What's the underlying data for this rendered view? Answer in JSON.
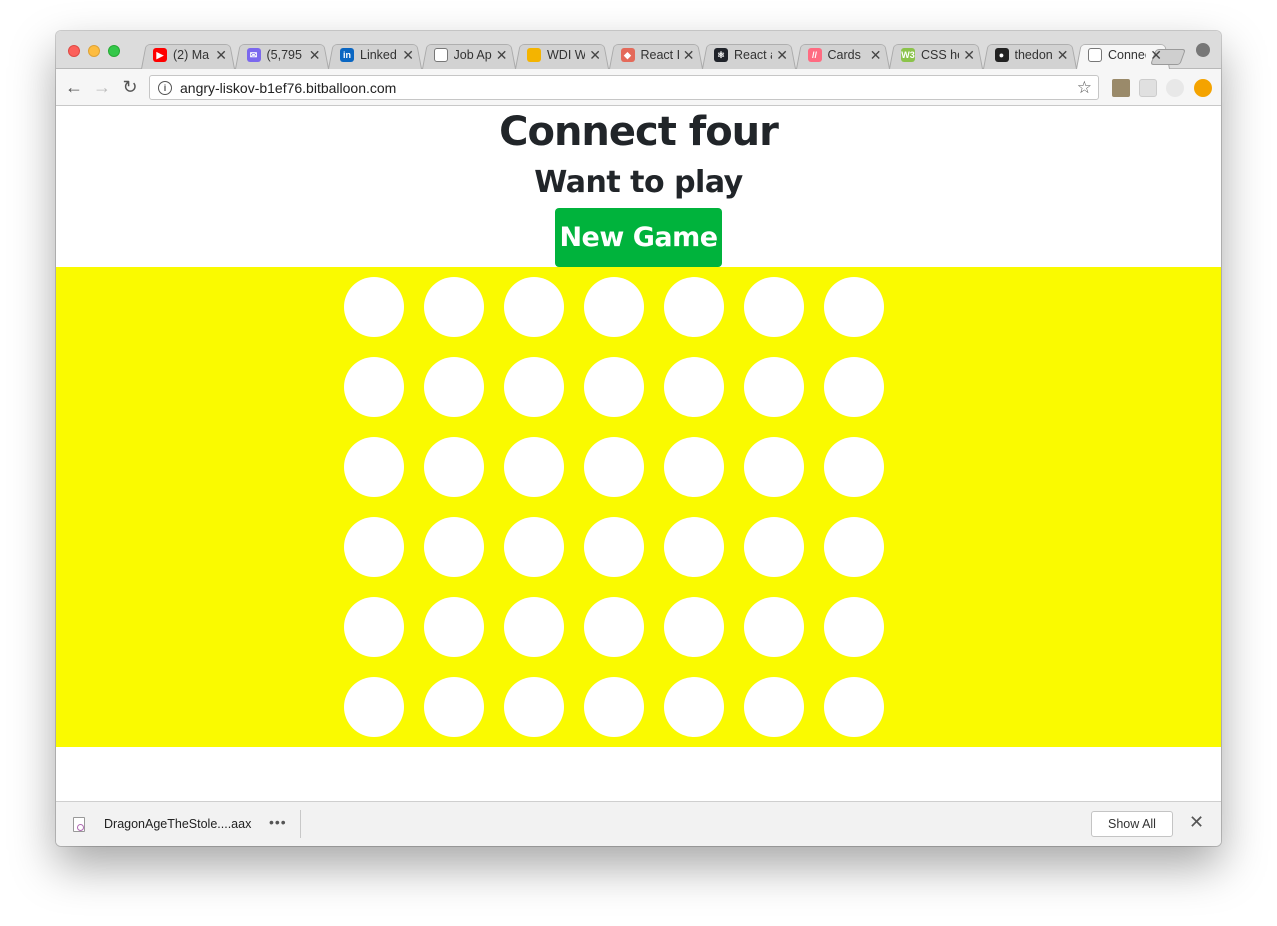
{
  "browser": {
    "tabs": [
      {
        "title": "(2) Ma",
        "favicon": "youtube-icon",
        "color": "#ff0000",
        "glyph": "▶"
      },
      {
        "title": "(5,795",
        "favicon": "mail-icon",
        "color": "#7b68ee",
        "glyph": "✉"
      },
      {
        "title": "Linked",
        "favicon": "linkedin-icon",
        "color": "#0a66c2",
        "glyph": "in"
      },
      {
        "title": "Job Ap",
        "favicon": "document-icon",
        "color": "#ffffff",
        "glyph": ""
      },
      {
        "title": "WDI W",
        "favicon": "slides-icon",
        "color": "#f4b400",
        "glyph": ""
      },
      {
        "title": "React I",
        "favicon": "diamond-icon",
        "color": "#e46a5a",
        "glyph": "◆"
      },
      {
        "title": "React a",
        "favicon": "react-icon",
        "color": "#20232a",
        "glyph": "⚛"
      },
      {
        "title": "Cards",
        "favicon": "cards-icon",
        "color": "#ff6b81",
        "glyph": "//"
      },
      {
        "title": "CSS he",
        "favicon": "css-icon",
        "color": "#8bc34a",
        "glyph": "W3"
      },
      {
        "title": "thedon",
        "favicon": "github-icon",
        "color": "#222222",
        "glyph": "●"
      },
      {
        "title": "Connec",
        "favicon": "document-icon",
        "color": "#ffffff",
        "glyph": ""
      }
    ],
    "tab_close_glyph": "✕",
    "url": "angry-liskov-b1ef76.bitballoon.com",
    "back_glyph": "←",
    "forward_glyph": "→",
    "reload_glyph": "↻",
    "star_glyph": "☆",
    "info_glyph": "i"
  },
  "page": {
    "title": "Connect four",
    "subtitle": "Want to play",
    "new_game_label": "New Game",
    "board_color": "#fafa00",
    "button_color": "#00b33c"
  },
  "board": {
    "rows": 6,
    "columns": 7,
    "cells": [
      [
        "empty",
        "empty",
        "empty",
        "empty",
        "empty",
        "empty",
        "empty"
      ],
      [
        "empty",
        "empty",
        "empty",
        "empty",
        "empty",
        "empty",
        "empty"
      ],
      [
        "empty",
        "empty",
        "empty",
        "empty",
        "empty",
        "empty",
        "empty"
      ],
      [
        "empty",
        "empty",
        "empty",
        "empty",
        "empty",
        "empty",
        "empty"
      ],
      [
        "empty",
        "empty",
        "empty",
        "empty",
        "empty",
        "empty",
        "empty"
      ],
      [
        "empty",
        "empty",
        "empty",
        "empty",
        "empty",
        "empty",
        "empty"
      ]
    ]
  },
  "downloads": {
    "filename": "DragonAgeTheStole....aax",
    "more_glyph": "•••",
    "show_all_label": "Show All",
    "close_glyph": "✕"
  }
}
